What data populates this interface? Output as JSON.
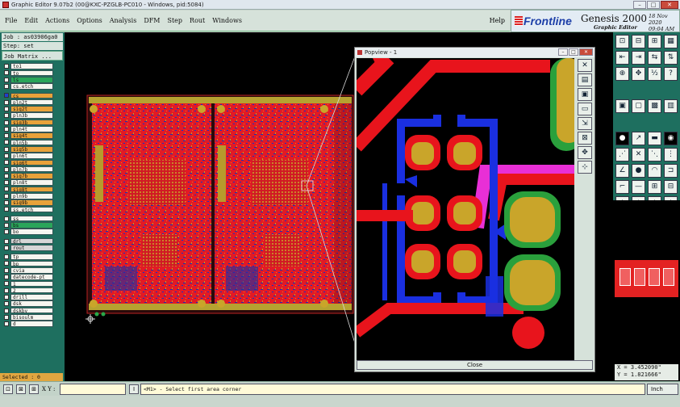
{
  "window": {
    "title": "Graphic Editor 9.07b2 (00@KXC-PZGLB-PC010 - Windows, pid:5084)",
    "buttons": [
      "–",
      "□",
      "✕"
    ]
  },
  "menu": {
    "items": [
      "File",
      "Edit",
      "Actions",
      "Options",
      "Analysis",
      "DFM",
      "Step",
      "Rout",
      "Windows"
    ],
    "help": "Help"
  },
  "brand": {
    "logo": "Frontline",
    "product": "Genesis 2000",
    "subtitle": "Graphic Editor",
    "date": "18 Nov 2020",
    "time": "09:04 AM"
  },
  "job": {
    "job_line": "Job : as03906ga0",
    "step_line": "Step: set",
    "matrix_button": "Job Matrix ..."
  },
  "layers": [
    {
      "name": "to1",
      "color": "#f6f6f0",
      "on": false
    },
    {
      "name": "to",
      "color": "#f6f6f0",
      "on": false
    },
    {
      "name": "ls",
      "color": "#2aa55a",
      "on": false
    },
    {
      "name": "cs.etch",
      "color": "#f6f6f0",
      "on": false
    },
    {
      "name": "cs",
      "color": "#e8a23a",
      "on": true,
      "gap_before": true
    },
    {
      "name": "pln2t",
      "color": "#f6f6f0",
      "on": false
    },
    {
      "name": "sig2t",
      "color": "#e8a23a",
      "on": false
    },
    {
      "name": "pln3b",
      "color": "#f6f6f0",
      "on": false
    },
    {
      "name": "sig3b",
      "color": "#e8a23a",
      "on": false
    },
    {
      "name": "pln4t",
      "color": "#f6f6f0",
      "on": false
    },
    {
      "name": "sig4t",
      "color": "#e8a23a",
      "on": false
    },
    {
      "name": "pln5b",
      "color": "#f6f6f0",
      "on": false
    },
    {
      "name": "sig5b",
      "color": "#e8a23a",
      "on": false
    },
    {
      "name": "pln6t",
      "color": "#f6f6f0",
      "on": false
    },
    {
      "name": "sig6t",
      "color": "#e8a23a",
      "on": false
    },
    {
      "name": "pln7b",
      "color": "#f6f6f0",
      "on": false
    },
    {
      "name": "sig7b",
      "color": "#e8a23a",
      "on": false
    },
    {
      "name": "pln8t",
      "color": "#f6f6f0",
      "on": false
    },
    {
      "name": "sig8t",
      "color": "#e8a23a",
      "on": false
    },
    {
      "name": "pln9b",
      "color": "#f6f6f0",
      "on": false
    },
    {
      "name": "sig9b",
      "color": "#e8a23a",
      "on": false
    },
    {
      "name": "ss.etch",
      "color": "#f6f6f0",
      "on": false
    },
    {
      "name": "ss",
      "color": "#f6f6f0",
      "on": false,
      "gap_before": true
    },
    {
      "name": "bs",
      "color": "#2aa55a",
      "on": false
    },
    {
      "name": "bo",
      "color": "#f6f6f0",
      "on": false
    },
    {
      "name": "drl",
      "color": "#d6d6d6",
      "on": false,
      "gap_before": true
    },
    {
      "name": "rout",
      "color": "#d6d6d6",
      "on": false
    },
    {
      "name": "tp",
      "color": "#f6f6f0",
      "on": false,
      "gap_before": true
    },
    {
      "name": "bp",
      "color": "#f6f6f0",
      "on": false
    },
    {
      "name": "cvia",
      "color": "#f6f6f0",
      "on": false
    },
    {
      "name": "datecode-pt",
      "color": "#f6f6f0",
      "on": false
    },
    {
      "name": "1",
      "color": "#f6f6f0",
      "on": false
    },
    {
      "name": "2",
      "color": "#f6f6f0",
      "on": false
    },
    {
      "name": "drill",
      "color": "#f6f6f0",
      "on": false
    },
    {
      "name": "dsk",
      "color": "#f6f6f0",
      "on": false
    },
    {
      "name": "dskby",
      "color": "#f6f6f0",
      "on": false
    },
    {
      "name": "bisoulm",
      "color": "#f6f6f0",
      "on": false
    },
    {
      "name": "d",
      "color": "#f6f6f0",
      "on": false
    }
  ],
  "selected_text": "Selected : 0",
  "popview": {
    "title": "Popview - 1",
    "close_label": "Close",
    "tools": [
      "✕",
      "▤",
      "▣",
      "▭",
      "⇲",
      "⊠",
      "✥",
      "⊹"
    ]
  },
  "toolbox": {
    "rows": [
      [
        "⊡",
        "⊟",
        "⊞",
        "▦"
      ],
      [
        "⇤",
        "⇥",
        "⇆",
        "⇅"
      ],
      [
        "⊕",
        "✥",
        "½",
        "?"
      ],
      [
        "▣",
        "▢",
        "▩",
        "▥"
      ],
      [
        "●",
        "↗",
        "▬",
        "◉"
      ],
      [
        "⋰",
        "✕",
        "⋱",
        "⋮"
      ],
      [
        "∠",
        "●",
        "◠",
        "⊐"
      ],
      [
        "⌐",
        "—",
        "⊞",
        "⊟"
      ],
      [
        "△",
        "▲",
        "△",
        "◭"
      ],
      [
        "↖",
        "↖",
        "↖",
        "↖"
      ]
    ]
  },
  "coords": {
    "x": "X = 3.452090\"",
    "y": "Y = 1.821666\""
  },
  "status": {
    "xy_label": "X Y :",
    "message": "<M1> - Select first area corner",
    "units": "Inch"
  }
}
